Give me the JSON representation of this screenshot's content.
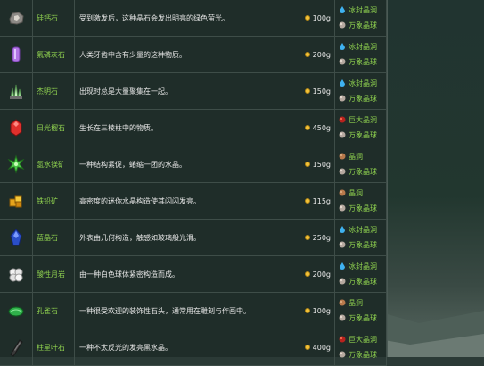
{
  "minerals": [
    {
      "icon": "geode-icon",
      "name": "硅钙石",
      "desc": "受到激发后，这种晶石会发出明亮的绿色萤光。",
      "price": "100g",
      "loc1_icon": "droplet-icon",
      "loc1": "冰封晶洞",
      "loc2_icon": "omni-geode-icon",
      "loc2": "万象晶球"
    },
    {
      "icon": "purple-crystal-icon",
      "name": "氟磷灰石",
      "desc": "人类牙齿中含有少量的这种物质。",
      "price": "200g",
      "loc1_icon": "droplet-icon",
      "loc1": "冰封晶洞",
      "loc2_icon": "omni-geode-icon",
      "loc2": "万象晶球"
    },
    {
      "icon": "green-crystal-cluster-icon",
      "name": "杰明石",
      "desc": "出现时总是大量聚集在一起。",
      "price": "150g",
      "loc1_icon": "droplet-icon",
      "loc1": "冰封晶洞",
      "loc2_icon": "omni-geode-icon",
      "loc2": "万象晶球"
    },
    {
      "icon": "red-crystal-icon",
      "name": "日光榴石",
      "desc": "生长在三棱柱中的物质。",
      "price": "450g",
      "loc1_icon": "magma-geode-icon",
      "loc1": "巨大晶洞",
      "loc2_icon": "omni-geode-icon",
      "loc2": "万象晶球"
    },
    {
      "icon": "green-star-crystal-icon",
      "name": "氢水镁矿",
      "desc": "一种结构紧促，蜷缩一团的水晶。",
      "price": "150g",
      "loc1_icon": "geode-small-icon",
      "loc1": "晶洞",
      "loc2_icon": "omni-geode-icon",
      "loc2": "万象晶球"
    },
    {
      "icon": "gold-ore-icon",
      "name": "铁铅矿",
      "desc": "高密度的迷你水晶构造使其闪闪发亮。",
      "price": "115g",
      "loc1_icon": "geode-small-icon",
      "loc1": "晶洞",
      "loc2_icon": "omni-geode-icon",
      "loc2": "万象晶球"
    },
    {
      "icon": "blue-crystal-icon",
      "name": "蓝晶石",
      "desc": "外表由几何构造，触感如玻璃般光滑。",
      "price": "250g",
      "loc1_icon": "droplet-icon",
      "loc1": "冰封晶洞",
      "loc2_icon": "omni-geode-icon",
      "loc2": "万象晶球"
    },
    {
      "icon": "white-cluster-icon",
      "name": "酸性月岩",
      "desc": "由一种白色球体紧密构造而成。",
      "price": "200g",
      "loc1_icon": "droplet-icon",
      "loc1": "冰封晶洞",
      "loc2_icon": "omni-geode-icon",
      "loc2": "万象晶球"
    },
    {
      "icon": "malachite-icon",
      "name": "孔雀石",
      "desc": "一种很受欢迎的装饰性石头，通常用在雕刻与作画中。",
      "price": "100g",
      "loc1_icon": "geode-small-icon",
      "loc1": "晶洞",
      "loc2_icon": "omni-geode-icon",
      "loc2": "万象晶球"
    },
    {
      "icon": "obsidian-shard-icon",
      "name": "柱星叶石",
      "desc": "一种不太反光的发亮黑水晶。",
      "price": "400g",
      "loc1_icon": "magma-geode-icon",
      "loc1": "巨大晶洞",
      "loc2_icon": "omni-geode-icon",
      "loc2": "万象晶球"
    }
  ],
  "colors": {
    "name": "#8fd14f",
    "location": "#8fd14f",
    "coin": "#f2c23b"
  }
}
